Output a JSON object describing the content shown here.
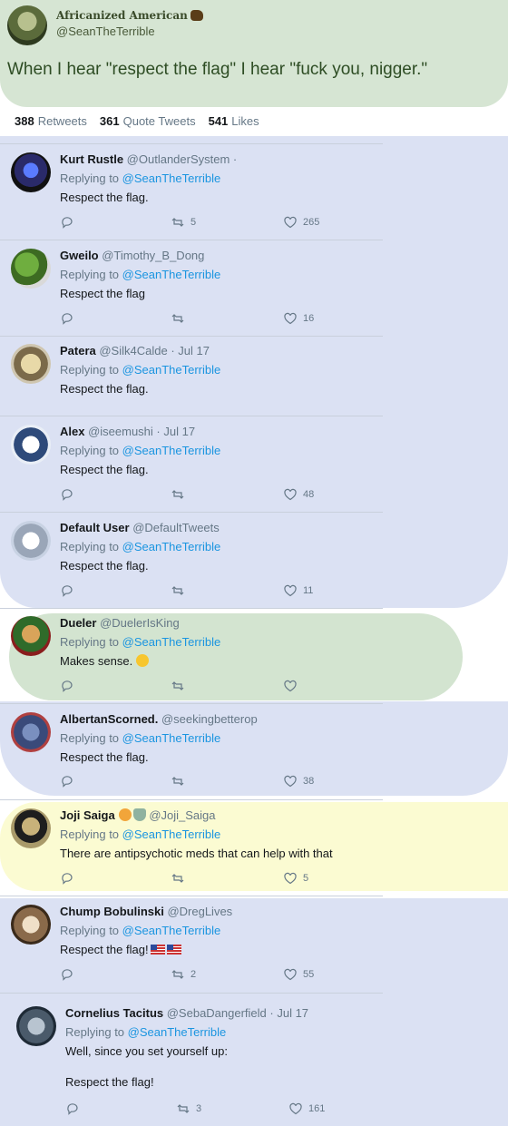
{
  "tweet": {
    "author_name": "Africanized American",
    "author_handle": "@SeanTheTerrible",
    "text": "When I hear \"respect the flag\" I hear \"fuck you, nigger.\"",
    "stats": {
      "retweets": "388",
      "retweets_label": "Retweets",
      "quotes": "361",
      "quotes_label": "Quote Tweets",
      "likes": "541",
      "likes_label": "Likes"
    }
  },
  "replies": [
    {
      "name": "Kurt Rustle",
      "handle": "@OutlanderSystem ·",
      "date": "",
      "replying": "Replying to",
      "to": "@SeanTheTerrible",
      "text": "Respect the flag.",
      "retweets": "5",
      "likes": "265"
    },
    {
      "name": "Gweilo",
      "handle": "@Timothy_B_Dong",
      "date": "",
      "replying": "Replying to",
      "to": "@SeanTheTerrible",
      "text": "Respect the flag",
      "retweets": "",
      "likes": "16"
    },
    {
      "name": "Patera",
      "handle": "@Silk4Calde",
      "date": " · Jul 17",
      "replying": "Replying to",
      "to": "@SeanTheTerrible",
      "text": "Respect the flag.",
      "retweets": "",
      "likes": ""
    },
    {
      "name": "Alex",
      "handle": "@iseemushi",
      "date": " · Jul 17",
      "replying": "Replying to",
      "to": "@SeanTheTerrible",
      "text": "Respect the flag.",
      "retweets": "",
      "likes": "48"
    },
    {
      "name": "Default User",
      "handle": "@DefaultTweets",
      "date": "",
      "replying": "Replying to",
      "to": "@SeanTheTerrible",
      "text": "Respect the flag.",
      "retweets": "",
      "likes": "11"
    },
    {
      "name": "Dueler",
      "handle": "@DuelerIsKing",
      "date": "",
      "replying": "Replying to",
      "to": "@SeanTheTerrible",
      "text": "Makes sense.",
      "retweets": "",
      "likes": ""
    },
    {
      "name": "AlbertanScorned.",
      "handle": "@seekingbetterop",
      "date": "",
      "replying": "Replying to",
      "to": "@SeanTheTerrible",
      "text": "Respect the flag.",
      "retweets": "",
      "likes": "38"
    },
    {
      "name": "Joji Saiga",
      "handle": "@Joji_Saiga",
      "date": "",
      "replying": "Replying to",
      "to": "@SeanTheTerrible",
      "text": "There are antipsychotic meds that can help with that",
      "retweets": "",
      "likes": "5"
    },
    {
      "name": "Chump Bobulinski",
      "handle": "@DregLives",
      "date": "",
      "replying": "Replying to",
      "to": "@SeanTheTerrible",
      "text": "Respect the flag!",
      "retweets": "2",
      "likes": "55"
    },
    {
      "name": "Cornelius Tacitus",
      "handle": "@SebaDangerfield",
      "date": " · Jul 17",
      "replying": "Replying to",
      "to": "@SeanTheTerrible",
      "text": "Well, since you set yourself up:",
      "text2": "Respect the flag!",
      "retweets": "3",
      "likes": "161"
    }
  ],
  "colors": {
    "link": "#1b95e0",
    "muted": "#657786",
    "green_highlight": "#d6e5d3",
    "blue_highlight": "#dbe1f3",
    "yellow_highlight": "#fbfbd2"
  },
  "icons": [
    "reply-icon",
    "retweet-icon",
    "like-icon"
  ]
}
